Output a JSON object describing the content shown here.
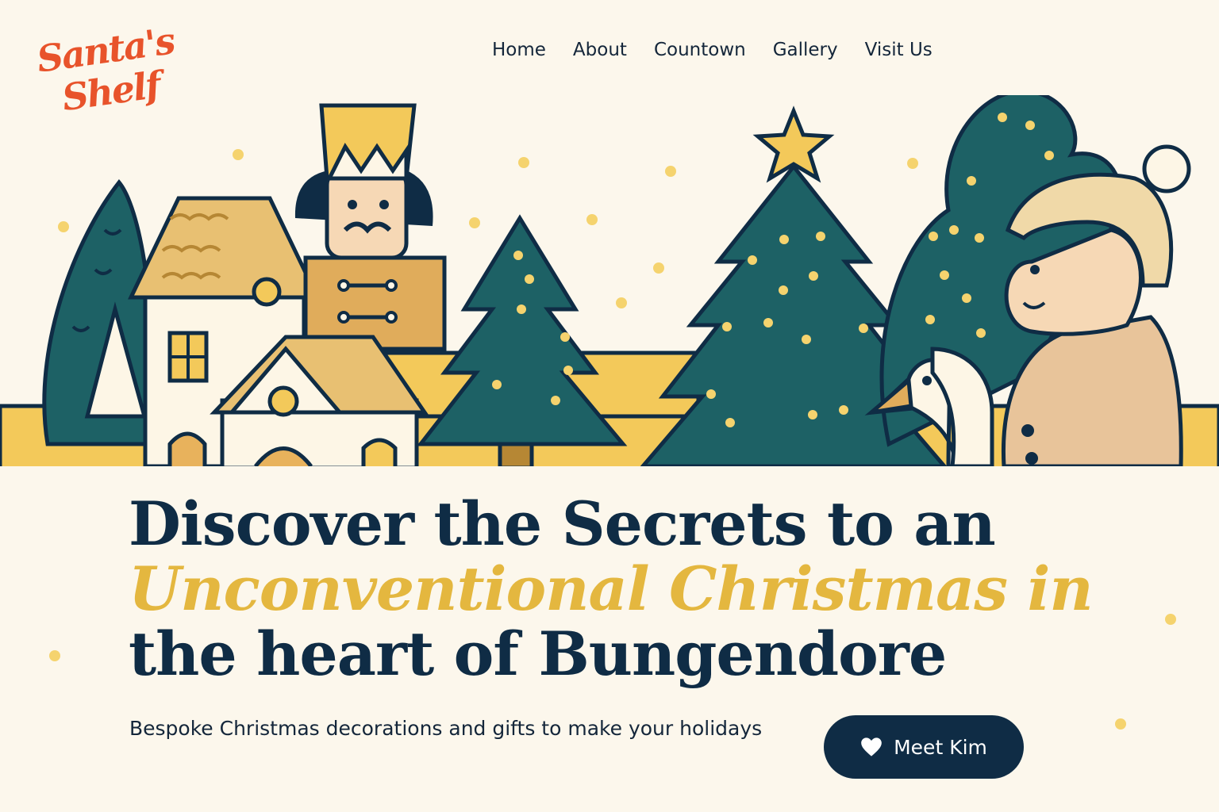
{
  "brand": {
    "line1": "Santa's",
    "line2": "Shelf"
  },
  "nav": {
    "items": [
      "Home",
      "About",
      "Countown",
      "Gallery",
      "Visit Us"
    ]
  },
  "hero": {
    "line1": "Discover the Secrets to an",
    "line2": "Unconventional Christmas in",
    "line3": "the heart of Bungendore",
    "subtitle": "Bespoke Christmas decorations and gifts to make your holidays",
    "cta_label": "Meet Kim"
  },
  "colors": {
    "background": "#fcf7ec",
    "navy": "#0f2c45",
    "gold": "#e4b73f",
    "teal": "#1d6165",
    "logo_orange": "#e8532b"
  },
  "icons": {
    "cta": "heart-icon"
  }
}
